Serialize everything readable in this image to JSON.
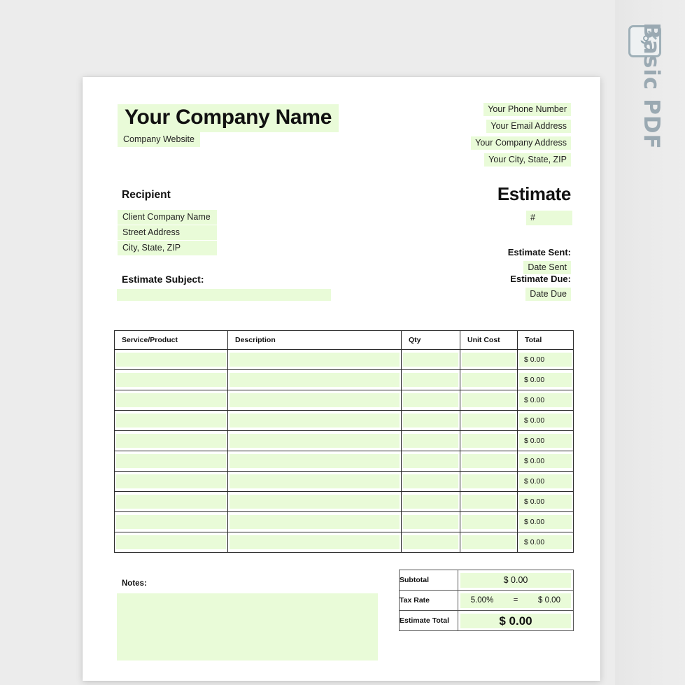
{
  "watermark": {
    "label": "Basic PDF",
    "icon": "pdf-document-icon"
  },
  "document": {
    "header": {
      "company_name": "Your Company Name",
      "company_website": "Company Website",
      "contact_lines": [
        "Your Phone Number",
        "Your Email Address",
        "Your Company Address",
        "Your City, State, ZIP"
      ]
    },
    "recipient": {
      "title": "Recipient",
      "lines": [
        "Client Company Name",
        "Street Address",
        "City, State, ZIP"
      ],
      "subject_label": "Estimate Subject:",
      "subject_value": ""
    },
    "estimate": {
      "title": "Estimate",
      "number": "#",
      "sent_label": "Estimate Sent:",
      "sent_value": "Date Sent",
      "due_label": "Estimate Due:",
      "due_value": "Date Due"
    },
    "items_table": {
      "columns": [
        "Service/Product",
        "Description",
        "Qty",
        "Unit Cost",
        "Total"
      ],
      "rows": [
        {
          "service": "",
          "description": "",
          "qty": "",
          "unit_cost": "",
          "total": "$ 0.00"
        },
        {
          "service": "",
          "description": "",
          "qty": "",
          "unit_cost": "",
          "total": "$ 0.00"
        },
        {
          "service": "",
          "description": "",
          "qty": "",
          "unit_cost": "",
          "total": "$ 0.00"
        },
        {
          "service": "",
          "description": "",
          "qty": "",
          "unit_cost": "",
          "total": "$ 0.00"
        },
        {
          "service": "",
          "description": "",
          "qty": "",
          "unit_cost": "",
          "total": "$ 0.00"
        },
        {
          "service": "",
          "description": "",
          "qty": "",
          "unit_cost": "",
          "total": "$ 0.00"
        },
        {
          "service": "",
          "description": "",
          "qty": "",
          "unit_cost": "",
          "total": "$ 0.00"
        },
        {
          "service": "",
          "description": "",
          "qty": "",
          "unit_cost": "",
          "total": "$ 0.00"
        },
        {
          "service": "",
          "description": "",
          "qty": "",
          "unit_cost": "",
          "total": "$ 0.00"
        },
        {
          "service": "",
          "description": "",
          "qty": "",
          "unit_cost": "",
          "total": "$ 0.00"
        }
      ]
    },
    "notes": {
      "label": "Notes:",
      "value": ""
    },
    "totals": {
      "subtotal_label": "Subtotal",
      "subtotal_value": "$ 0.00",
      "tax_label": "Tax Rate",
      "tax_rate": "5.00%",
      "tax_equals": "=",
      "tax_amount": "$ 0.00",
      "total_label": "Estimate Total",
      "total_value": "$ 0.00"
    }
  },
  "colors": {
    "field_fill": "#e9fbd8",
    "page_background": "#ffffff",
    "canvas_background": "#ececec",
    "watermark_text": "#9aa9b2",
    "table_border": "#2b2b2b"
  }
}
